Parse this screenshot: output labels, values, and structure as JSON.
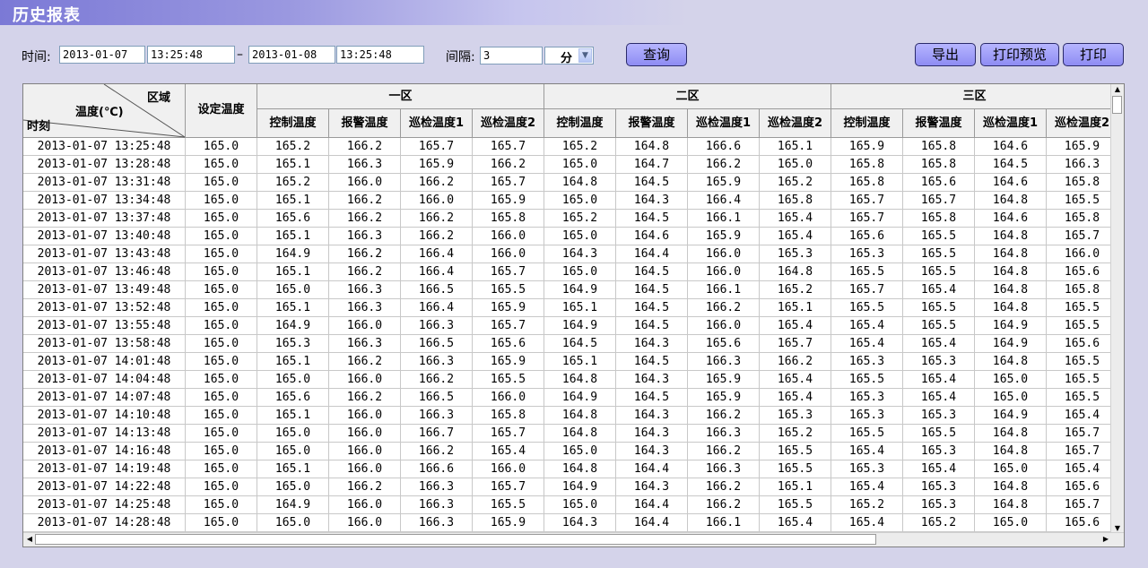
{
  "title": "历史报表",
  "filters": {
    "time_label": "时间:",
    "start_date": "2013-01-07",
    "start_time": "13:25:48",
    "separator": "–",
    "end_date": "2013-01-08",
    "end_time": "13:25:48",
    "interval_label": "间隔:",
    "interval_value": "3",
    "unit": "分"
  },
  "buttons": {
    "query": "查询",
    "export": "导出",
    "print_preview": "打印预览",
    "print": "打印"
  },
  "table": {
    "corner": {
      "zone": "区域",
      "temp": "温度(℃)",
      "time": "时刻"
    },
    "set_temp": "设定温度",
    "zones": [
      "一区",
      "二区",
      "三区"
    ],
    "subcols": [
      "控制温度",
      "报警温度",
      "巡检温度1",
      "巡检温度2"
    ],
    "rows": [
      [
        "2013-01-07 13:25:48",
        "165.0",
        "165.2",
        "166.2",
        "165.7",
        "165.7",
        "165.2",
        "164.8",
        "166.6",
        "165.1",
        "165.9",
        "165.8",
        "164.6",
        "165.9"
      ],
      [
        "2013-01-07 13:28:48",
        "165.0",
        "165.1",
        "166.3",
        "165.9",
        "166.2",
        "165.0",
        "164.7",
        "166.2",
        "165.0",
        "165.8",
        "165.8",
        "164.5",
        "166.3"
      ],
      [
        "2013-01-07 13:31:48",
        "165.0",
        "165.2",
        "166.0",
        "166.2",
        "165.7",
        "164.8",
        "164.5",
        "165.9",
        "165.2",
        "165.8",
        "165.6",
        "164.6",
        "165.8"
      ],
      [
        "2013-01-07 13:34:48",
        "165.0",
        "165.1",
        "166.2",
        "166.0",
        "165.9",
        "165.0",
        "164.3",
        "166.4",
        "165.8",
        "165.7",
        "165.7",
        "164.8",
        "165.5"
      ],
      [
        "2013-01-07 13:37:48",
        "165.0",
        "165.6",
        "166.2",
        "166.2",
        "165.8",
        "165.2",
        "164.5",
        "166.1",
        "165.4",
        "165.7",
        "165.8",
        "164.6",
        "165.8"
      ],
      [
        "2013-01-07 13:40:48",
        "165.0",
        "165.1",
        "166.3",
        "166.2",
        "166.0",
        "165.0",
        "164.6",
        "165.9",
        "165.4",
        "165.6",
        "165.5",
        "164.8",
        "165.7"
      ],
      [
        "2013-01-07 13:43:48",
        "165.0",
        "164.9",
        "166.2",
        "166.4",
        "166.0",
        "164.3",
        "164.4",
        "166.0",
        "165.3",
        "165.3",
        "165.5",
        "164.8",
        "166.0"
      ],
      [
        "2013-01-07 13:46:48",
        "165.0",
        "165.1",
        "166.2",
        "166.4",
        "165.7",
        "165.0",
        "164.5",
        "166.0",
        "164.8",
        "165.5",
        "165.5",
        "164.8",
        "165.6"
      ],
      [
        "2013-01-07 13:49:48",
        "165.0",
        "165.0",
        "166.3",
        "166.5",
        "165.5",
        "164.9",
        "164.5",
        "166.1",
        "165.2",
        "165.7",
        "165.4",
        "164.8",
        "165.8"
      ],
      [
        "2013-01-07 13:52:48",
        "165.0",
        "165.1",
        "166.3",
        "166.4",
        "165.9",
        "165.1",
        "164.5",
        "166.2",
        "165.1",
        "165.5",
        "165.5",
        "164.8",
        "165.5"
      ],
      [
        "2013-01-07 13:55:48",
        "165.0",
        "164.9",
        "166.0",
        "166.3",
        "165.7",
        "164.9",
        "164.5",
        "166.0",
        "165.4",
        "165.4",
        "165.5",
        "164.9",
        "165.5"
      ],
      [
        "2013-01-07 13:58:48",
        "165.0",
        "165.3",
        "166.3",
        "166.5",
        "165.6",
        "164.5",
        "164.3",
        "165.6",
        "165.7",
        "165.4",
        "165.4",
        "164.9",
        "165.6"
      ],
      [
        "2013-01-07 14:01:48",
        "165.0",
        "165.1",
        "166.2",
        "166.3",
        "165.9",
        "165.1",
        "164.5",
        "166.3",
        "166.2",
        "165.3",
        "165.3",
        "164.8",
        "165.5"
      ],
      [
        "2013-01-07 14:04:48",
        "165.0",
        "165.0",
        "166.0",
        "166.2",
        "165.5",
        "164.8",
        "164.3",
        "165.9",
        "165.4",
        "165.5",
        "165.4",
        "165.0",
        "165.5"
      ],
      [
        "2013-01-07 14:07:48",
        "165.0",
        "165.6",
        "166.2",
        "166.5",
        "166.0",
        "164.9",
        "164.5",
        "165.9",
        "165.4",
        "165.3",
        "165.4",
        "165.0",
        "165.5"
      ],
      [
        "2013-01-07 14:10:48",
        "165.0",
        "165.1",
        "166.0",
        "166.3",
        "165.8",
        "164.8",
        "164.3",
        "166.2",
        "165.3",
        "165.3",
        "165.3",
        "164.9",
        "165.4"
      ],
      [
        "2013-01-07 14:13:48",
        "165.0",
        "165.0",
        "166.0",
        "166.7",
        "165.7",
        "164.8",
        "164.3",
        "166.3",
        "165.2",
        "165.5",
        "165.5",
        "164.8",
        "165.7"
      ],
      [
        "2013-01-07 14:16:48",
        "165.0",
        "165.0",
        "166.0",
        "166.2",
        "165.4",
        "165.0",
        "164.3",
        "166.2",
        "165.5",
        "165.4",
        "165.3",
        "164.8",
        "165.7"
      ],
      [
        "2013-01-07 14:19:48",
        "165.0",
        "165.1",
        "166.0",
        "166.6",
        "166.0",
        "164.8",
        "164.4",
        "166.3",
        "165.5",
        "165.3",
        "165.4",
        "165.0",
        "165.4"
      ],
      [
        "2013-01-07 14:22:48",
        "165.0",
        "165.0",
        "166.2",
        "166.3",
        "165.7",
        "164.9",
        "164.3",
        "166.2",
        "165.1",
        "165.4",
        "165.3",
        "164.8",
        "165.6"
      ],
      [
        "2013-01-07 14:25:48",
        "165.0",
        "164.9",
        "166.0",
        "166.3",
        "165.5",
        "165.0",
        "164.4",
        "166.2",
        "165.5",
        "165.2",
        "165.3",
        "164.8",
        "165.7"
      ],
      [
        "2013-01-07 14:28:48",
        "165.0",
        "165.0",
        "166.0",
        "166.3",
        "165.9",
        "164.3",
        "164.4",
        "166.1",
        "165.4",
        "165.4",
        "165.2",
        "165.0",
        "165.6"
      ]
    ]
  }
}
